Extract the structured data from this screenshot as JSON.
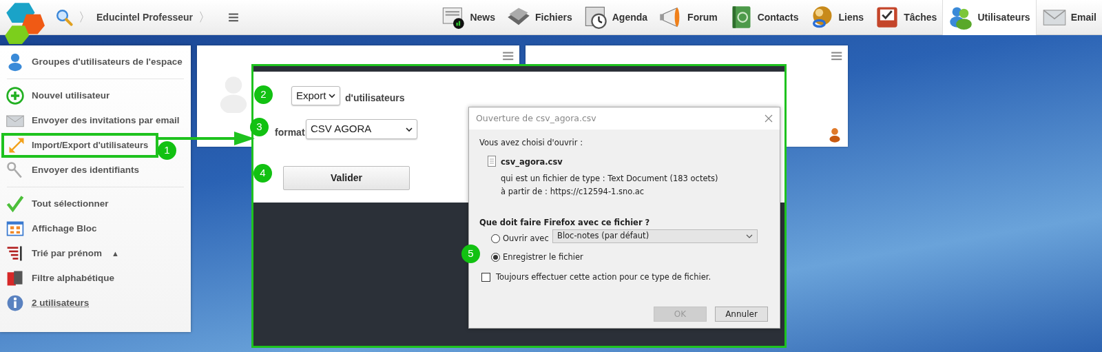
{
  "topbar": {
    "breadcrumb": "Educintel Professeur",
    "separators": [
      "〉",
      "〉"
    ]
  },
  "nav": [
    {
      "label": "News",
      "selected": false
    },
    {
      "label": "Fichiers",
      "selected": false
    },
    {
      "label": "Agenda",
      "selected": false
    },
    {
      "label": "Forum",
      "selected": false
    },
    {
      "label": "Contacts",
      "selected": false
    },
    {
      "label": "Liens",
      "selected": false
    },
    {
      "label": "Tâches",
      "selected": false
    },
    {
      "label": "Utilisateurs",
      "selected": true
    },
    {
      "label": "Email",
      "selected": false
    }
  ],
  "sidebar": {
    "sections": [
      {
        "items": [
          {
            "label": "Groupes d'utilisateurs de l'espace",
            "annotated": false
          }
        ]
      },
      {
        "items": [
          {
            "label": "Nouvel utilisateur",
            "annotated": false
          },
          {
            "label": "Envoyer des invitations par email",
            "annotated": false
          },
          {
            "label": "Import/Export d'utilisateurs",
            "annotated": true
          },
          {
            "label": "Envoyer des identifiants",
            "annotated": false
          }
        ]
      },
      {
        "items": [
          {
            "label": "Tout sélectionner",
            "annotated": false
          },
          {
            "label": "Affichage Bloc",
            "annotated": false
          },
          {
            "label": "Trié par prénom",
            "annotated": false,
            "sort_indicator": "▲"
          },
          {
            "label": "Filtre alphabétique",
            "annotated": false
          },
          {
            "label": "2 utilisateurs",
            "annotated": false
          }
        ]
      }
    ]
  },
  "callouts": [
    "1",
    "2",
    "3",
    "4",
    "5"
  ],
  "import_form": {
    "mode": {
      "value": "Export"
    },
    "mode_suffix": "d'utilisateurs",
    "format_label": "format",
    "format": {
      "value": "CSV AGORA"
    },
    "submit": "Valider"
  },
  "dialog": {
    "title": "Ouverture de csv_agora.csv",
    "intro": "Vous avez choisi d'ouvrir :",
    "file_name": "csv_agora.csv",
    "type_line": "qui est un fichier de type : Text Document (183 octets)",
    "source_label": "à partir de :",
    "source_url": "https://c12594-1.sno.ac",
    "question": "Que doit faire Firefox avec ce fichier ?",
    "options": [
      {
        "label": "Ouvrir avec",
        "selected": false,
        "app": "Bloc-notes (par défaut)"
      },
      {
        "label": "Enregistrer le fichier",
        "selected": true
      }
    ],
    "always": {
      "label": "Toujours effectuer cette action pour ce type de fichier.",
      "checked": false
    },
    "buttons": [
      {
        "label": "OK",
        "disabled": true
      },
      {
        "label": "Annuler",
        "disabled": false
      }
    ]
  }
}
